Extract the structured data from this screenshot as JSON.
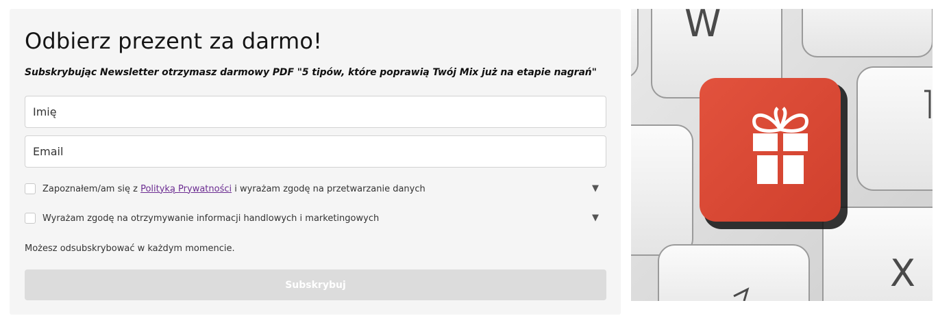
{
  "form": {
    "title": "Odbierz prezent za darmo!",
    "subtitle": "Subskrybując Newsletter otrzymasz darmowy PDF \"5 tipów, które poprawią Twój Mix już na etapie nagrań\"",
    "name_placeholder": "Imię",
    "email_placeholder": "Email",
    "consents": [
      {
        "text_before": "Zapoznałem/am się z ",
        "link_text": "Polityką Prywatności",
        "text_after": " i wyrażam zgodę na przetwarzanie danych",
        "checked": false,
        "expand_icon": "triangle-down-icon"
      },
      {
        "text_before": "Wyrażam zgodę na otrzymywanie informacji handlowych i marketingowych",
        "link_text": "",
        "text_after": "",
        "checked": false,
        "expand_icon": "triangle-down-icon"
      }
    ],
    "unsubscribe_note": "Możesz odsubskrybować w każdym momencie.",
    "submit_label": "Subskrybuj",
    "expand_glyph": "▼"
  },
  "image": {
    "description_icon": "gift-key-keyboard-image",
    "key_labels": [
      "W",
      "X"
    ],
    "accent_color": "#dd4a36"
  }
}
